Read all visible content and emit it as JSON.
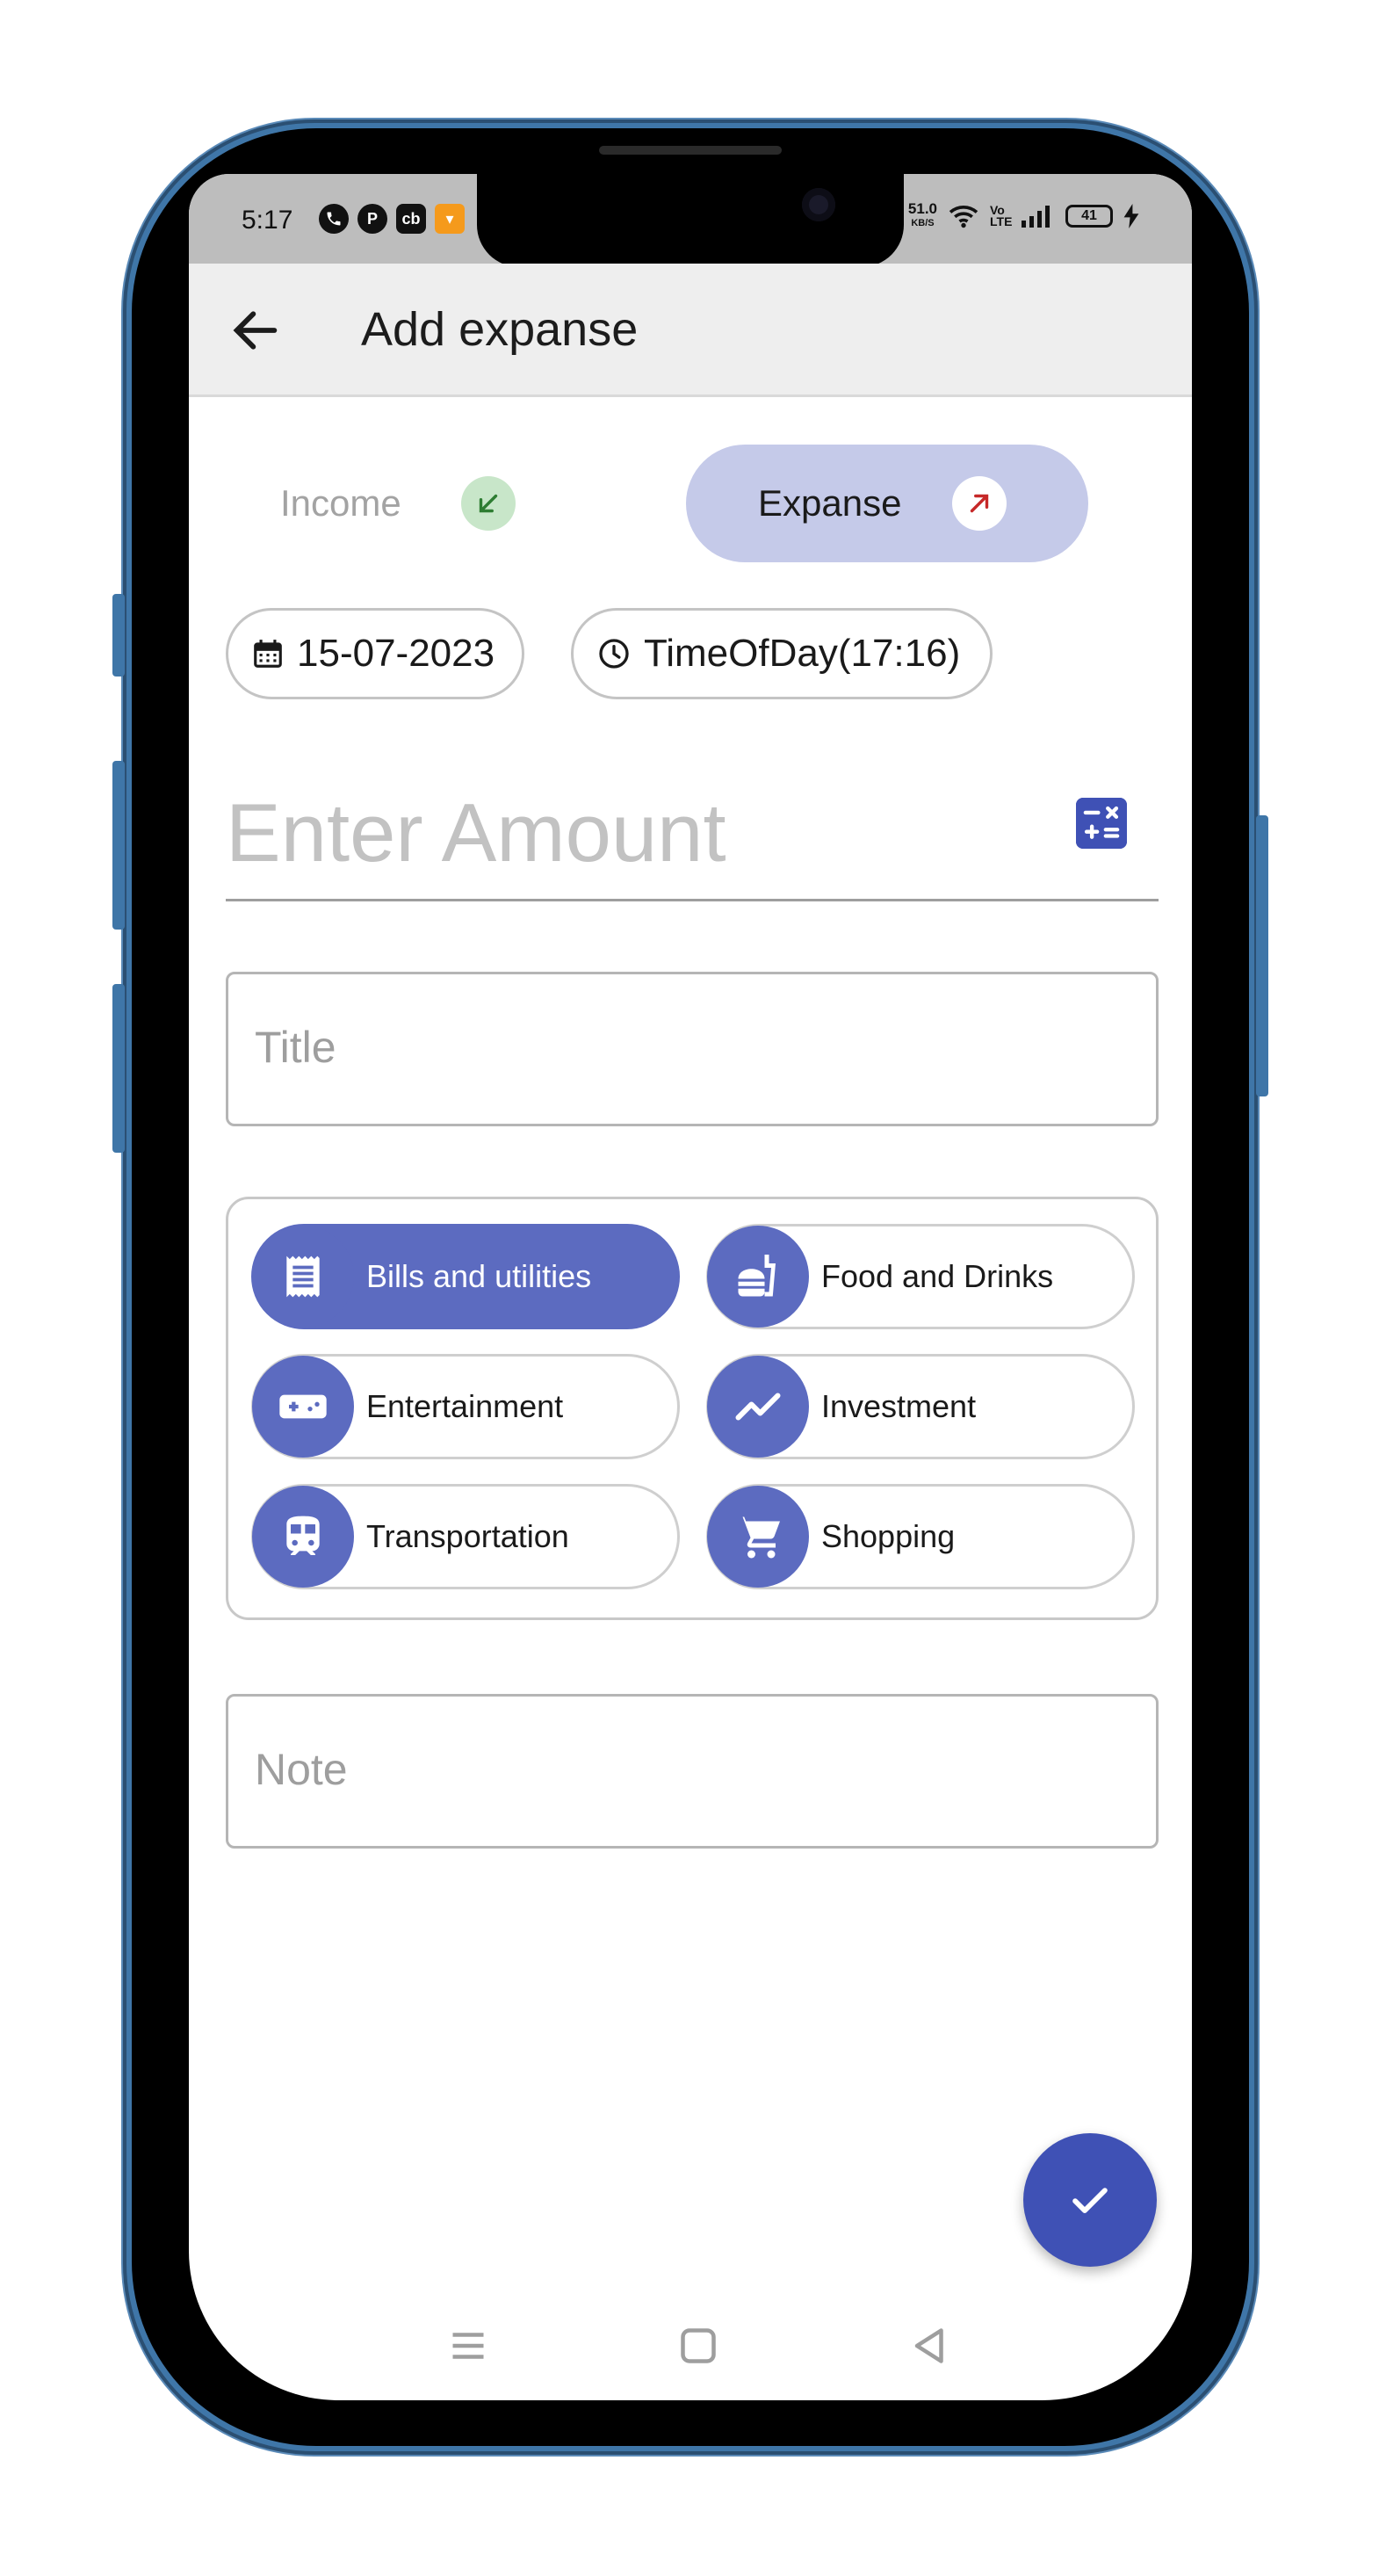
{
  "status_bar": {
    "time": "5:17",
    "network_speed_value": "51.0",
    "network_speed_unit": "KB/S",
    "volte": "Vo LTE",
    "battery": "41"
  },
  "app_bar": {
    "title": "Add expanse"
  },
  "type_toggle": {
    "income_label": "Income",
    "expense_label": "Expanse",
    "selected": "Expanse"
  },
  "date_chip": {
    "label": "15-07-2023"
  },
  "time_chip": {
    "label": "TimeOfDay(17:16)"
  },
  "amount": {
    "placeholder": "Enter Amount"
  },
  "title_field": {
    "placeholder": "Title"
  },
  "categories": [
    {
      "label": "Bills and utilities",
      "icon": "receipt-icon",
      "selected": true
    },
    {
      "label": "Food and Drinks",
      "icon": "fastfood-icon",
      "selected": false
    },
    {
      "label": "Entertainment",
      "icon": "gamepad-icon",
      "selected": false
    },
    {
      "label": "Investment",
      "icon": "trending-up-icon",
      "selected": false
    },
    {
      "label": "Transportation",
      "icon": "train-icon",
      "selected": false
    },
    {
      "label": "Shopping",
      "icon": "shopping-cart-icon",
      "selected": false
    }
  ],
  "note_field": {
    "placeholder": "Note"
  },
  "colors": {
    "primary": "#3f51b5",
    "category_accent": "#5c6bc0",
    "expense_toggle_bg": "#c5cae9",
    "income_icon_bg": "#c8e6c9",
    "income_arrow": "#2e7d32",
    "expense_arrow": "#c62828",
    "app_bar_bg": "#eeeeee",
    "status_bar_bg": "#bdbdbd",
    "phone_frame": "#3f76a8"
  }
}
